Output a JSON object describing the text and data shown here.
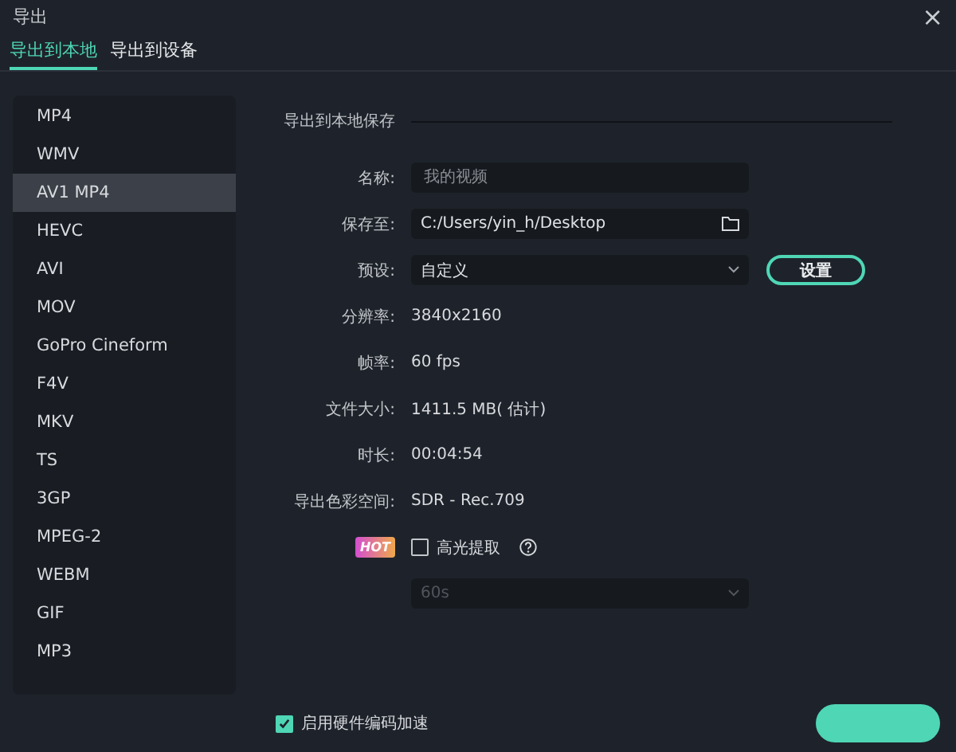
{
  "window": {
    "title": "导出",
    "close": "×"
  },
  "tabs": [
    {
      "label": "导出到本地",
      "selected": true
    },
    {
      "label": "导出到设备",
      "selected": false
    }
  ],
  "formats": [
    {
      "label": "MP4",
      "selected": false
    },
    {
      "label": "WMV",
      "selected": false
    },
    {
      "label": "AV1 MP4",
      "selected": true
    },
    {
      "label": "HEVC",
      "selected": false
    },
    {
      "label": "AVI",
      "selected": false
    },
    {
      "label": "MOV",
      "selected": false
    },
    {
      "label": "GoPro Cineform",
      "selected": false
    },
    {
      "label": "F4V",
      "selected": false
    },
    {
      "label": "MKV",
      "selected": false
    },
    {
      "label": "TS",
      "selected": false
    },
    {
      "label": "3GP",
      "selected": false
    },
    {
      "label": "MPEG-2",
      "selected": false
    },
    {
      "label": "WEBM",
      "selected": false
    },
    {
      "label": "GIF",
      "selected": false
    },
    {
      "label": "MP3",
      "selected": false
    }
  ],
  "section_title": "导出到本地保存",
  "fields": [
    {
      "kind": "input",
      "label": "名称:",
      "placeholder": "我的视频"
    },
    {
      "kind": "path",
      "label": "保存至:",
      "value": "C:/Users/yin_h/Desktop"
    },
    {
      "kind": "select",
      "label": "预设:",
      "value": "自定义",
      "button": "设置"
    },
    {
      "kind": "info",
      "label": "分辨率:",
      "value": "3840x2160"
    },
    {
      "kind": "info",
      "label": "帧率:",
      "value": "60 fps"
    },
    {
      "kind": "info",
      "label": "文件大小:",
      "value": "1411.5 MB( 估计)"
    },
    {
      "kind": "info",
      "label": "时长:",
      "value": "00:04:54"
    },
    {
      "kind": "info",
      "label": "导出色彩空间:",
      "value": "SDR - Rec.709"
    },
    {
      "kind": "checkbox",
      "badge": "HOT",
      "label": "高光提取",
      "checked": false
    },
    {
      "kind": "select",
      "value": "60s",
      "disabled": true
    }
  ],
  "hardware_acceleration": {
    "label": "启用硬件编码加速",
    "checked": true
  }
}
